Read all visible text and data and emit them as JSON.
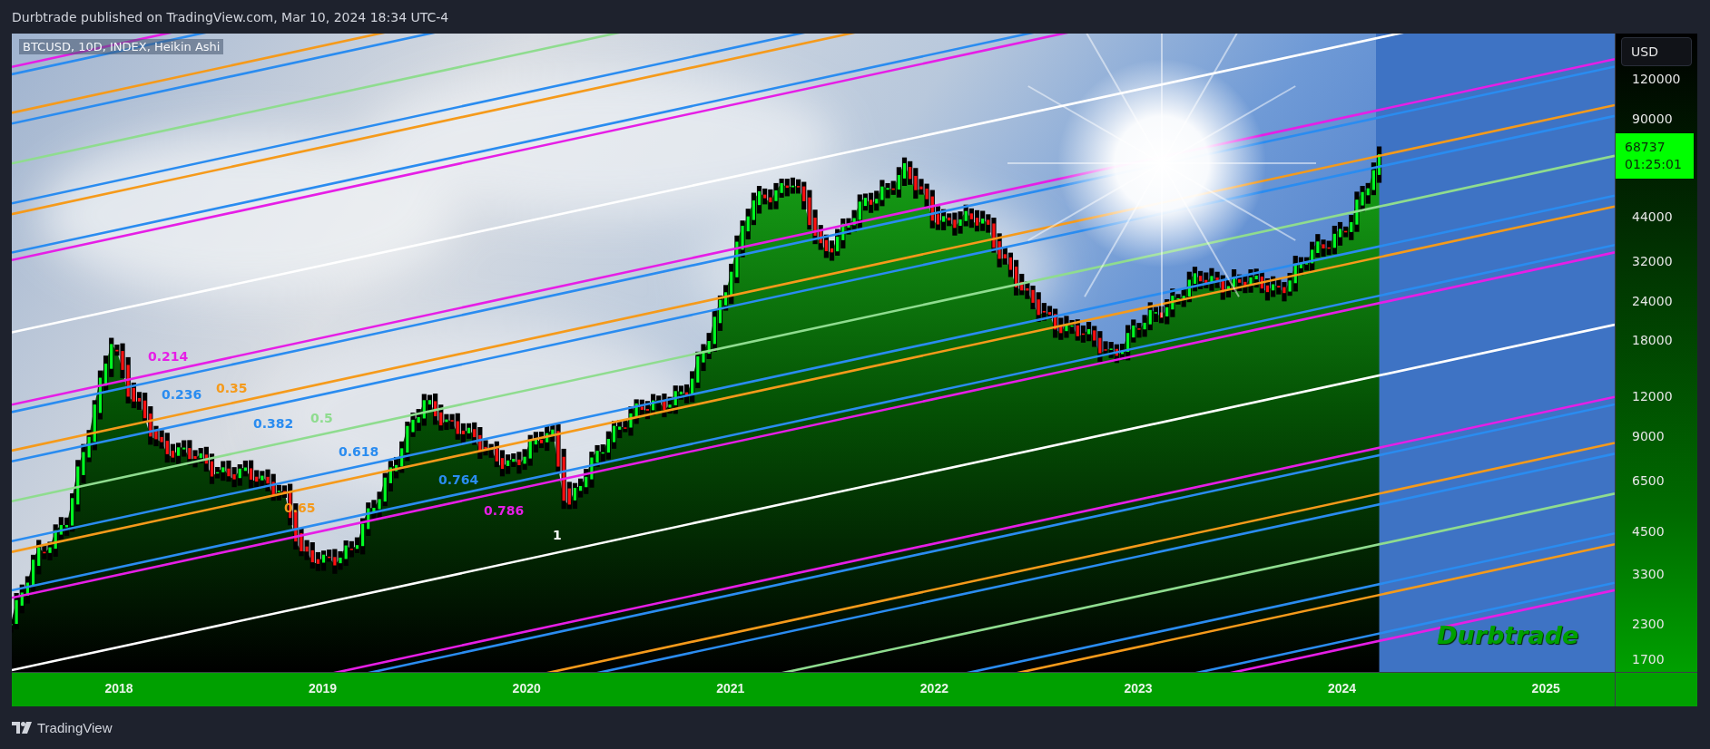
{
  "header": {
    "text": "Durbtrade published on TradingView.com, Mar 10, 2024 18:34 UTC-4"
  },
  "chart": {
    "legend": "BTCUSD, 10D, INDEX, Heikin Ashi",
    "signature": "Durbtrade",
    "fib_labels": [
      {
        "label": "0.214",
        "color": "#e61ee6"
      },
      {
        "label": "0.236",
        "color": "#2a8cf0"
      },
      {
        "label": "0.35",
        "color": "#f59a1b"
      },
      {
        "label": "0.382",
        "color": "#2a8cf0"
      },
      {
        "label": "0.5",
        "color": "#8fdc8f"
      },
      {
        "label": "0.618",
        "color": "#2a8cf0"
      },
      {
        "label": "0.65",
        "color": "#f59a1b"
      },
      {
        "label": "0.764",
        "color": "#2a8cf0"
      },
      {
        "label": "0.786",
        "color": "#e61ee6"
      },
      {
        "label": "1",
        "color": "#ffffff"
      }
    ]
  },
  "price_axis": {
    "currency": "USD",
    "ticks": [
      "120000",
      "90000",
      "44000",
      "32000",
      "24000",
      "18000",
      "12000",
      "9000",
      "6500",
      "4500",
      "3300",
      "2300",
      "1700"
    ],
    "last_price": "68737",
    "countdown": "01:25:01"
  },
  "time_axis": [
    "2018",
    "2019",
    "2020",
    "2021",
    "2022",
    "2023",
    "2024",
    "2025"
  ],
  "footer": {
    "brand": "TradingView"
  }
}
